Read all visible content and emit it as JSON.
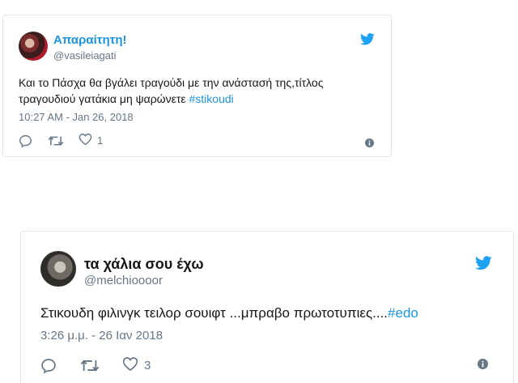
{
  "tweets": [
    {
      "name": "Απαραίτητη!",
      "handle": "@vasileiagati",
      "text": "Και το Πάσχα θα βγάλει τραγούδι με την ανάστασή της,τίτλος τραγουδιού γατάκια μη ψαρώνετε ",
      "hashtag": "#stikoudi",
      "timestamp": "10:27 AM - Jan 26, 2018",
      "like_count": "1",
      "icons": [
        "reply-icon",
        "retweet-icon",
        "like-icon",
        "info-icon",
        "twitter-bird-icon"
      ]
    },
    {
      "name": "τα χάλια σου έχω",
      "handle": "@melchioooor",
      "text": "Στικουδη φιλινγκ τειλορ σουιφτ ...μπραβο πρωτοτυπιες....",
      "hashtag": "#edo",
      "timestamp": "3:26 μ.μ. - 26 Ιαν 2018",
      "like_count": "3",
      "icons": [
        "reply-icon",
        "retweet-icon",
        "like-icon",
        "info-icon",
        "twitter-bird-icon"
      ]
    }
  ],
  "colors": {
    "link": "#1b95e0",
    "muted": "#657786",
    "border": "#e1e8ed",
    "bird": "#1da1f2"
  }
}
